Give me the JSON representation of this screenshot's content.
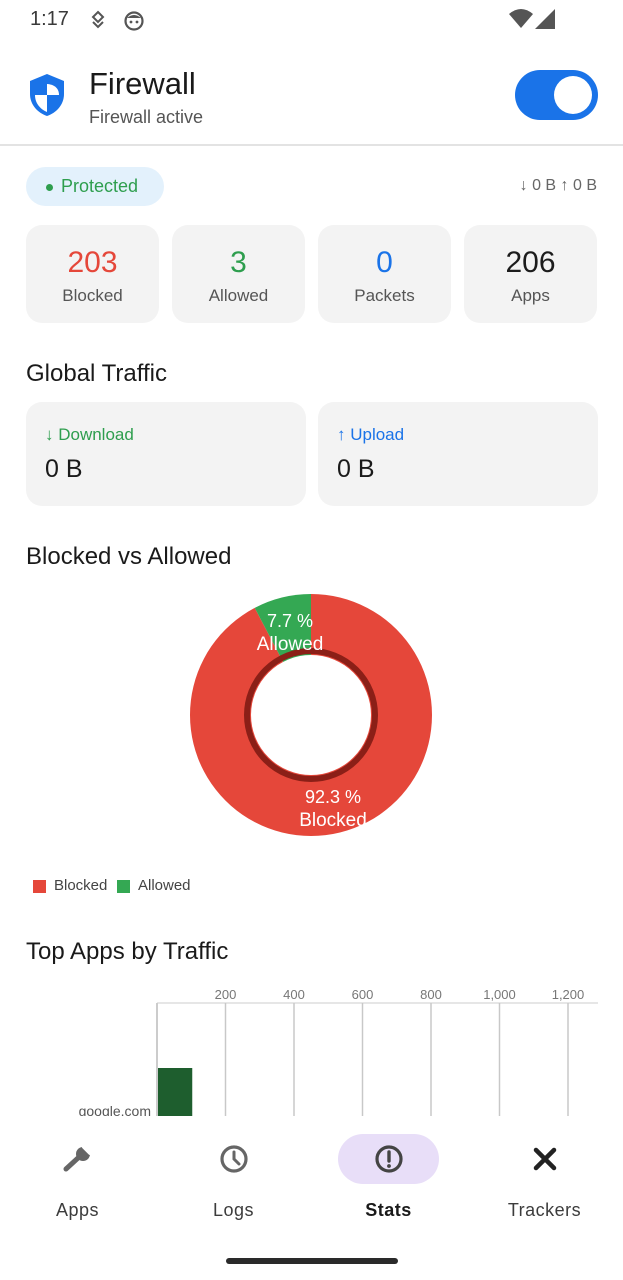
{
  "status_bar": {
    "time": "1:17"
  },
  "header": {
    "title": "Firewall",
    "subtitle": "Firewall active",
    "toggle_on": true
  },
  "status": {
    "badge": "Protected",
    "traffic_summary": "↓ 0 B  ↑ 0 B"
  },
  "stats": [
    {
      "value": "203",
      "label": "Blocked",
      "color": "#e5473a"
    },
    {
      "value": "3",
      "label": "Allowed",
      "color": "#2e9e4e"
    },
    {
      "value": "0",
      "label": "Packets",
      "color": "#1a73e8"
    },
    {
      "value": "206",
      "label": "Apps",
      "color": "#1c1c1c"
    }
  ],
  "global_traffic": {
    "title": "Global Traffic",
    "download": {
      "label": "↓ Download",
      "value": "0 B",
      "color": "#2e9e4e"
    },
    "upload": {
      "label": "↑ Upload",
      "value": "0 B",
      "color": "#1a73e8"
    }
  },
  "blocked_vs_allowed": {
    "title": "Blocked vs Allowed",
    "chart_data": {
      "type": "pie",
      "categories": [
        "Blocked",
        "Allowed"
      ],
      "values": [
        92.3,
        7.7
      ],
      "value_labels": [
        "92.3 %",
        "7.7 %"
      ],
      "colors": [
        "#e5473a",
        "#34a853"
      ],
      "legend": "bottom-left"
    }
  },
  "top_apps": {
    "title": "Top Apps by Traffic",
    "chart_data": {
      "type": "bar",
      "orientation": "horizontal",
      "categories": [
        "google.com"
      ],
      "values": [
        100
      ],
      "xticks": [
        "200",
        "400",
        "600",
        "800",
        "1,000",
        "1,200"
      ],
      "xlim": [
        0,
        1200
      ],
      "color": "#1e5e2e"
    }
  },
  "nav": {
    "items": [
      {
        "label": "Apps",
        "icon": "wrench-icon",
        "active": false
      },
      {
        "label": "Logs",
        "icon": "clock-icon",
        "active": false
      },
      {
        "label": "Stats",
        "icon": "info-icon",
        "active": true
      },
      {
        "label": "Trackers",
        "icon": "close-icon",
        "active": false
      }
    ]
  }
}
